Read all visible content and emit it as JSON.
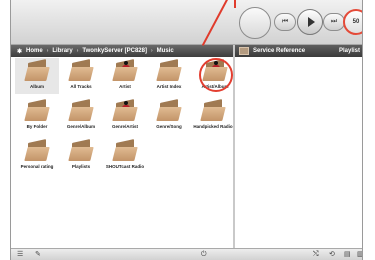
{
  "breadcrumb": {
    "star_icon": "star-icon",
    "items": [
      "Home",
      "Library",
      "TwonkyServer [PC828]",
      "Music"
    ],
    "separator": "›"
  },
  "right_panel": {
    "title": "Service Reference",
    "tab": "Playlist"
  },
  "tiles": [
    {
      "label": "Album",
      "icon": "folder-icon",
      "selected": true
    },
    {
      "label": "All Tracks",
      "icon": "folder-icon"
    },
    {
      "label": "Artist",
      "icon": "folder-person-icon"
    },
    {
      "label": "Artist Index",
      "icon": "folder-icon"
    },
    {
      "label": "Artist/Album",
      "icon": "folder-person-icon",
      "highlighted": true
    },
    {
      "label": "By Folder",
      "icon": "folder-icon"
    },
    {
      "label": "Genre/Album",
      "icon": "folder-icon"
    },
    {
      "label": "Genre/Artist",
      "icon": "folder-person-icon"
    },
    {
      "label": "Genre/Song",
      "icon": "folder-icon"
    },
    {
      "label": "Handpicked Radio",
      "icon": "folder-icon"
    },
    {
      "label": "Personal rating",
      "icon": "folder-icon"
    },
    {
      "label": "Playlists",
      "icon": "folder-icon"
    },
    {
      "label": "SHOUTcast Radio",
      "icon": "folder-icon"
    }
  ],
  "controls": {
    "prev": "⏮",
    "next": "⏭",
    "volume": "50"
  },
  "colors": {
    "annotation": "#e03b2c",
    "folder": "#c89a6c",
    "header_bar": "#4a4a4a"
  }
}
